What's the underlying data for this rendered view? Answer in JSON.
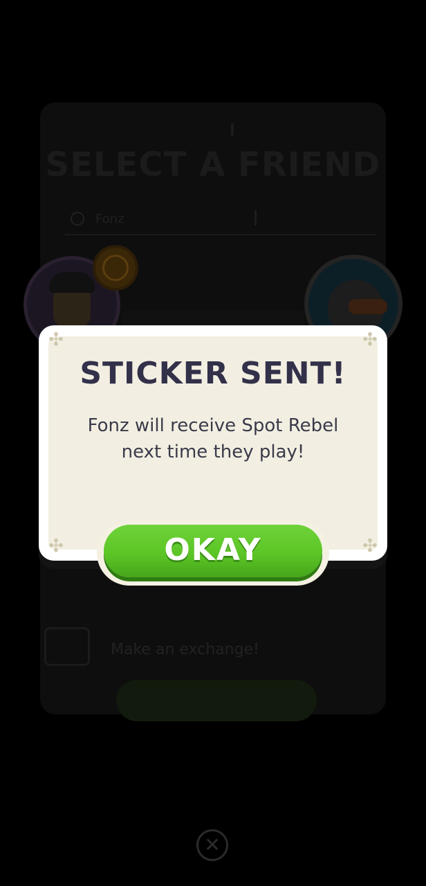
{
  "background_dialog": {
    "title": "SELECT A FRIEND",
    "search_value": "Fonz",
    "row_label": "Make an exchange!",
    "button_label": ""
  },
  "popup": {
    "title": "STICKER SENT!",
    "message_line1": "Fonz will receive Spot Rebel",
    "message_line2": "next time they play!",
    "okay_label": "OKAY"
  },
  "icons": {
    "corner": "✣",
    "close": "✕"
  },
  "colors": {
    "okay_green": "#5cc626",
    "title_text": "#33304a",
    "panel_bg": "#f2efe2"
  }
}
